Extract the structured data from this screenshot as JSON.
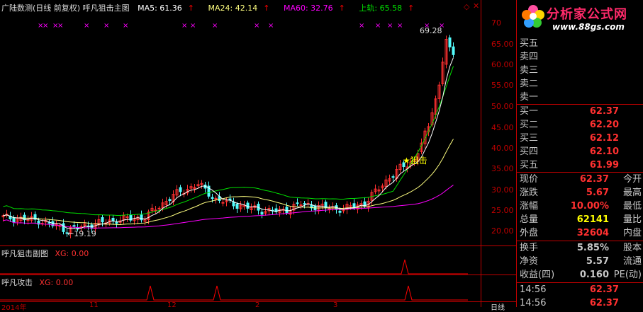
{
  "header": {
    "title": "广陆数测(日线 前复权) 呼凡狙击主图",
    "ma5": "MA5: 61.36",
    "ma24": "MA24: 42.14",
    "ma60": "MA60: 32.76",
    "upper": "上轨: 65.58",
    "arrow": "↑"
  },
  "logo": {
    "text": "分析家公式网",
    "url": "www.88gs.com"
  },
  "annotations": {
    "peak": "69.28",
    "low": "←19.19",
    "signal": "★狙击"
  },
  "y_axis": [
    "70",
    "65.00",
    "60.00",
    "55.00",
    "50.00",
    "45.00",
    "40.00",
    "35.00",
    "30.00",
    "25.00",
    "20.00"
  ],
  "sub1": {
    "title": "呼凡狙击副图",
    "xg": "XG: 0.00"
  },
  "sub2": {
    "title": "呼凡攻击",
    "xg": "XG: 0.00"
  },
  "x_axis": [
    "2014年",
    "11",
    "12",
    "2",
    "3"
  ],
  "x_axis_right": "日线",
  "orderbook": {
    "asks": [
      {
        "label": "买五",
        "value": ""
      },
      {
        "label": "卖四",
        "value": ""
      },
      {
        "label": "卖三",
        "value": ""
      },
      {
        "label": "卖二",
        "value": ""
      },
      {
        "label": "卖一",
        "value": ""
      }
    ],
    "bids": [
      {
        "label": "买一",
        "value": "62.37"
      },
      {
        "label": "买二",
        "value": "62.20"
      },
      {
        "label": "买三",
        "value": "62.12"
      },
      {
        "label": "买四",
        "value": "62.10"
      },
      {
        "label": "买五",
        "value": "61.99"
      }
    ]
  },
  "stats": [
    {
      "label": "现价",
      "value": "62.37",
      "right": "今开",
      "color": "#ff3030"
    },
    {
      "label": "涨跌",
      "value": "5.67",
      "right": "最高",
      "color": "#ff3030"
    },
    {
      "label": "涨幅",
      "value": "10.00%",
      "right": "最低",
      "color": "#ff3030"
    },
    {
      "label": "总量",
      "value": "62141",
      "right": "量比",
      "color": "#ffff00"
    },
    {
      "label": "外盘",
      "value": "32604",
      "right": "内盘",
      "color": "#ff3030"
    }
  ],
  "stats2": [
    {
      "label": "换手",
      "value": "5.85%",
      "right": "股本",
      "color": "#c8c8c8"
    },
    {
      "label": "净资",
      "value": "5.57",
      "right": "流通",
      "color": "#c8c8c8"
    },
    {
      "label": "收益(四)",
      "value": "0.160",
      "right": "PE(动)",
      "color": "#c8c8c8"
    }
  ],
  "ticks": [
    {
      "time": "14:56",
      "price": "62.37"
    },
    {
      "time": "14:56",
      "price": "62.37"
    }
  ],
  "colors": {
    "up": "#ff3030",
    "down": "#54fcfc",
    "ma5": "#ffffff",
    "ma24": "#ffff80",
    "ma60": "#ff00ff",
    "upper": "#00e000",
    "border": "#c00000"
  }
}
